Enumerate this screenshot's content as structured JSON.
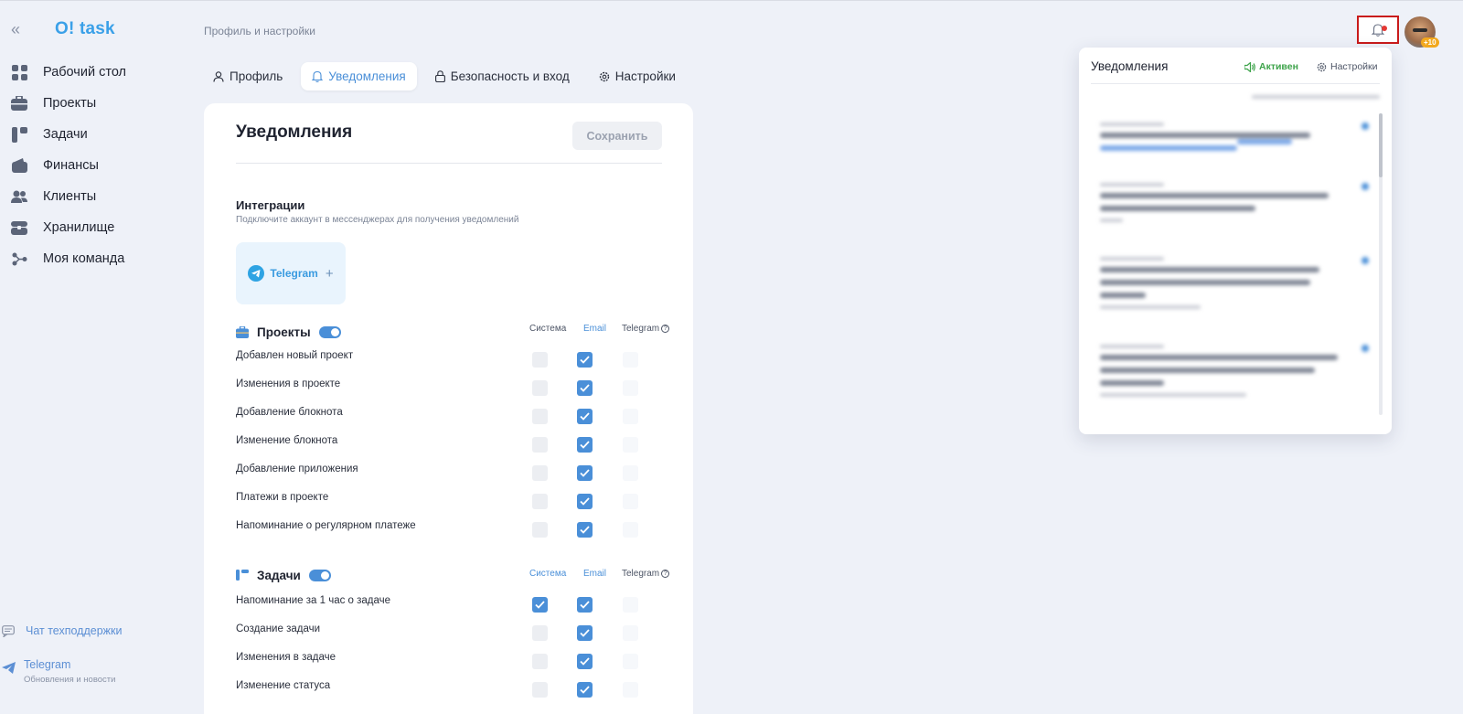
{
  "app": {
    "logo": "O! task",
    "collapse_icon": "«"
  },
  "sidebar": {
    "items": [
      {
        "label": "Рабочий стол",
        "icon": "dashboard-icon"
      },
      {
        "label": "Проекты",
        "icon": "briefcase-icon"
      },
      {
        "label": "Задачи",
        "icon": "tasks-icon"
      },
      {
        "label": "Финансы",
        "icon": "wallet-icon"
      },
      {
        "label": "Клиенты",
        "icon": "clients-icon"
      },
      {
        "label": "Хранилище",
        "icon": "storage-icon"
      },
      {
        "label": "Моя команда",
        "icon": "team-icon"
      }
    ],
    "support_label": "Чат техподдержки",
    "telegram": {
      "title": "Telegram",
      "subtitle": "Обновления и новости"
    }
  },
  "header": {
    "breadcrumb": "Профиль и настройки",
    "tabs": [
      {
        "label": "Профиль",
        "active": false
      },
      {
        "label": "Уведомления",
        "active": true
      },
      {
        "label": "Безопасность и вход",
        "active": false
      },
      {
        "label": "Настройки",
        "active": false
      }
    ],
    "avatar_badge": "+10"
  },
  "main": {
    "title": "Уведомления",
    "save_label": "Сохранить",
    "integrations": {
      "title": "Интеграции",
      "subtitle": "Подключите аккаунт в мессенджерах для получения уведомлений",
      "telegram_label": "Telegram",
      "add_symbol": "+"
    },
    "columns": {
      "system": "Система",
      "email": "Email",
      "telegram": "Telegram"
    },
    "sections": [
      {
        "name": "Проекты",
        "enabled": true,
        "rows": [
          {
            "label": "Добавлен новый проект",
            "system": false,
            "email": true
          },
          {
            "label": "Изменения в проекте",
            "system": false,
            "email": true
          },
          {
            "label": "Добавление блокнота",
            "system": false,
            "email": true
          },
          {
            "label": "Изменение блокнота",
            "system": false,
            "email": true
          },
          {
            "label": "Добавление приложения",
            "system": false,
            "email": true
          },
          {
            "label": "Платежи в проекте",
            "system": false,
            "email": true
          },
          {
            "label": "Напоминание о регулярном платеже",
            "system": false,
            "email": true
          }
        ]
      },
      {
        "name": "Задачи",
        "enabled": true,
        "rows": [
          {
            "label": "Напоминание за 1 час о задаче",
            "system": true,
            "email": true
          },
          {
            "label": "Создание задачи",
            "system": false,
            "email": true
          },
          {
            "label": "Изменения в задаче",
            "system": false,
            "email": true
          },
          {
            "label": "Изменение статуса",
            "system": false,
            "email": true
          }
        ]
      }
    ]
  },
  "notifications_panel": {
    "title": "Уведомления",
    "status": "Активен",
    "settings_label": "Настройки"
  },
  "colors": {
    "accent": "#4a8fd8",
    "logo": "#3aa0e8",
    "active_status": "#3da34a",
    "highlight_border": "#c91b1b"
  }
}
